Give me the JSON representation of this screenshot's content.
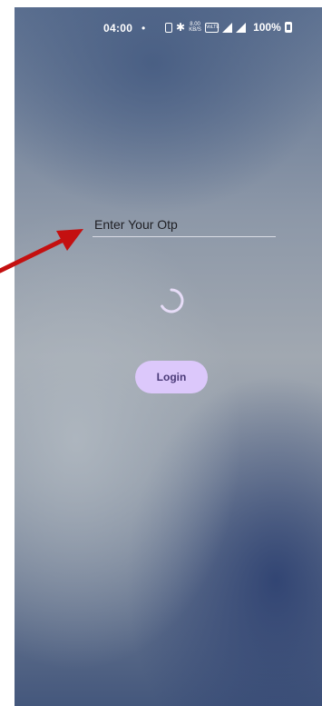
{
  "status_bar": {
    "time": "04:00",
    "dot": "•",
    "speed_top": "8.00",
    "speed_bottom": "KB/S",
    "volte": "VoLTE",
    "battery": "100%"
  },
  "icons": {
    "vibrate": "vibrate-icon",
    "bluetooth": "bluetooth-icon",
    "signal": "signal-icon",
    "battery": "battery-icon",
    "spinner": "loading-spinner-icon",
    "annotation": "red-arrow-annotation"
  },
  "form": {
    "otp_placeholder": "Enter Your Otp",
    "otp_value": "",
    "login_label": "Login"
  },
  "colors": {
    "login_button_bg": "#dcc8fb",
    "login_button_text": "#4a3a78",
    "annotation_arrow": "#c41010",
    "spinner": "#e6dcf7"
  }
}
